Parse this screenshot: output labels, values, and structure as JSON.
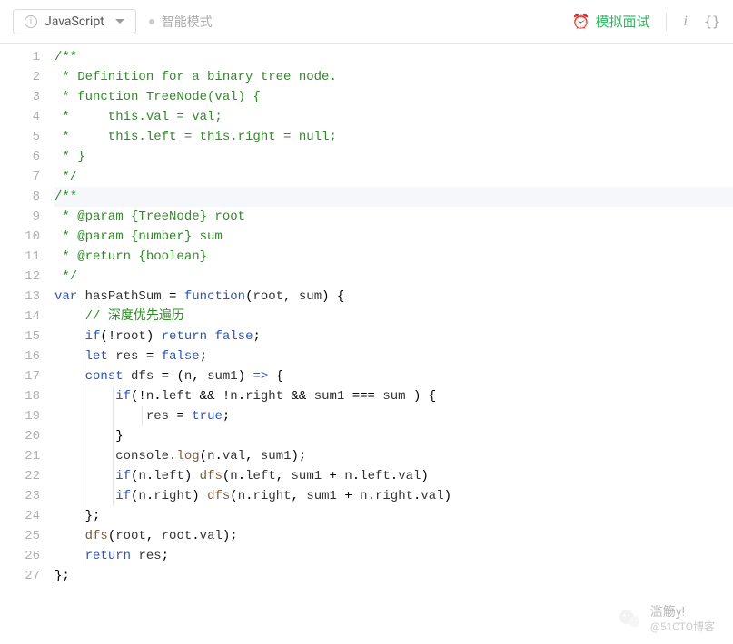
{
  "toolbar": {
    "language": "JavaScript",
    "mode_label": "智能模式",
    "interview_label": "模拟面试"
  },
  "icons": {
    "info": "i",
    "braces": "{}"
  },
  "watermark": {
    "line1": "滥觞y!",
    "line2": "@51CTO博客"
  },
  "code": {
    "highlight_line": 8,
    "lines": [
      {
        "n": 1,
        "seg": [
          {
            "t": "/**",
            "c": "c-comment"
          }
        ]
      },
      {
        "n": 2,
        "seg": [
          {
            "t": " * Definition for a binary tree node.",
            "c": "c-comment"
          }
        ]
      },
      {
        "n": 3,
        "seg": [
          {
            "t": " * function TreeNode(val) {",
            "c": "c-comment"
          }
        ]
      },
      {
        "n": 4,
        "seg": [
          {
            "t": " *     this.val = val;",
            "c": "c-comment"
          }
        ]
      },
      {
        "n": 5,
        "seg": [
          {
            "t": " *     this.left = this.right = null;",
            "c": "c-comment"
          }
        ]
      },
      {
        "n": 6,
        "seg": [
          {
            "t": " * }",
            "c": "c-comment"
          }
        ]
      },
      {
        "n": 7,
        "seg": [
          {
            "t": " */",
            "c": "c-comment"
          }
        ]
      },
      {
        "n": 8,
        "seg": [
          {
            "t": "/**",
            "c": "c-comment"
          }
        ]
      },
      {
        "n": 9,
        "seg": [
          {
            "t": " * @param {TreeNode} root",
            "c": "c-comment"
          }
        ]
      },
      {
        "n": 10,
        "seg": [
          {
            "t": " * @param {number} sum",
            "c": "c-comment"
          }
        ]
      },
      {
        "n": 11,
        "seg": [
          {
            "t": " * @return {boolean}",
            "c": "c-comment"
          }
        ]
      },
      {
        "n": 12,
        "seg": [
          {
            "t": " */",
            "c": "c-comment"
          }
        ]
      },
      {
        "n": 13,
        "guides": [],
        "seg": [
          {
            "t": "var",
            "c": "c-keyword"
          },
          {
            "t": " "
          },
          {
            "t": "hasPathSum",
            "c": "c-ident"
          },
          {
            "t": " = "
          },
          {
            "t": "function",
            "c": "c-keyword"
          },
          {
            "t": "("
          },
          {
            "t": "root",
            "c": "c-ident"
          },
          {
            "t": ", "
          },
          {
            "t": "sum",
            "c": "c-ident"
          },
          {
            "t": ") {"
          }
        ]
      },
      {
        "n": 14,
        "guides": [
          "g1"
        ],
        "seg": [
          {
            "t": "    "
          },
          {
            "t": "// 深度优先遍历",
            "c": "c-comment"
          }
        ]
      },
      {
        "n": 15,
        "guides": [
          "g1"
        ],
        "seg": [
          {
            "t": "    "
          },
          {
            "t": "if",
            "c": "c-keyword"
          },
          {
            "t": "(!"
          },
          {
            "t": "root",
            "c": "c-ident"
          },
          {
            "t": ") "
          },
          {
            "t": "return",
            "c": "c-keyword"
          },
          {
            "t": " "
          },
          {
            "t": "false",
            "c": "c-keyword"
          },
          {
            "t": ";"
          }
        ]
      },
      {
        "n": 16,
        "guides": [
          "g1"
        ],
        "seg": [
          {
            "t": "    "
          },
          {
            "t": "let",
            "c": "c-keyword"
          },
          {
            "t": " "
          },
          {
            "t": "res",
            "c": "c-ident"
          },
          {
            "t": " = "
          },
          {
            "t": "false",
            "c": "c-keyword"
          },
          {
            "t": ";"
          }
        ]
      },
      {
        "n": 17,
        "guides": [
          "g1"
        ],
        "seg": [
          {
            "t": "    "
          },
          {
            "t": "const",
            "c": "c-keyword"
          },
          {
            "t": " "
          },
          {
            "t": "dfs",
            "c": "c-ident"
          },
          {
            "t": " = ("
          },
          {
            "t": "n",
            "c": "c-ident"
          },
          {
            "t": ", "
          },
          {
            "t": "sum1",
            "c": "c-ident"
          },
          {
            "t": ") "
          },
          {
            "t": "=>",
            "c": "c-keyword"
          },
          {
            "t": " {"
          }
        ]
      },
      {
        "n": 18,
        "guides": [
          "g1",
          "g2"
        ],
        "seg": [
          {
            "t": "        "
          },
          {
            "t": "if",
            "c": "c-keyword"
          },
          {
            "t": "(!"
          },
          {
            "t": "n",
            "c": "c-ident"
          },
          {
            "t": "."
          },
          {
            "t": "left",
            "c": "c-ident"
          },
          {
            "t": " && !"
          },
          {
            "t": "n",
            "c": "c-ident"
          },
          {
            "t": "."
          },
          {
            "t": "right",
            "c": "c-ident"
          },
          {
            "t": " && "
          },
          {
            "t": "sum1",
            "c": "c-ident"
          },
          {
            "t": " === "
          },
          {
            "t": "sum",
            "c": "c-ident"
          },
          {
            "t": " ) {"
          }
        ]
      },
      {
        "n": 19,
        "guides": [
          "g1",
          "g2",
          "g3"
        ],
        "seg": [
          {
            "t": "            "
          },
          {
            "t": "res",
            "c": "c-ident"
          },
          {
            "t": " = "
          },
          {
            "t": "true",
            "c": "c-keyword"
          },
          {
            "t": ";"
          }
        ]
      },
      {
        "n": 20,
        "guides": [
          "g1",
          "g2"
        ],
        "seg": [
          {
            "t": "        }"
          }
        ]
      },
      {
        "n": 21,
        "guides": [
          "g1",
          "g2"
        ],
        "seg": [
          {
            "t": "        "
          },
          {
            "t": "console",
            "c": "c-ident"
          },
          {
            "t": "."
          },
          {
            "t": "log",
            "c": "c-func"
          },
          {
            "t": "("
          },
          {
            "t": "n",
            "c": "c-ident"
          },
          {
            "t": "."
          },
          {
            "t": "val",
            "c": "c-ident"
          },
          {
            "t": ", "
          },
          {
            "t": "sum1",
            "c": "c-ident"
          },
          {
            "t": ");"
          }
        ]
      },
      {
        "n": 22,
        "guides": [
          "g1",
          "g2"
        ],
        "seg": [
          {
            "t": "        "
          },
          {
            "t": "if",
            "c": "c-keyword"
          },
          {
            "t": "("
          },
          {
            "t": "n",
            "c": "c-ident"
          },
          {
            "t": "."
          },
          {
            "t": "left",
            "c": "c-ident"
          },
          {
            "t": ") "
          },
          {
            "t": "dfs",
            "c": "c-func"
          },
          {
            "t": "("
          },
          {
            "t": "n",
            "c": "c-ident"
          },
          {
            "t": "."
          },
          {
            "t": "left",
            "c": "c-ident"
          },
          {
            "t": ", "
          },
          {
            "t": "sum1",
            "c": "c-ident"
          },
          {
            "t": " + "
          },
          {
            "t": "n",
            "c": "c-ident"
          },
          {
            "t": "."
          },
          {
            "t": "left",
            "c": "c-ident"
          },
          {
            "t": "."
          },
          {
            "t": "val",
            "c": "c-ident"
          },
          {
            "t": ")"
          }
        ]
      },
      {
        "n": 23,
        "guides": [
          "g1",
          "g2"
        ],
        "seg": [
          {
            "t": "        "
          },
          {
            "t": "if",
            "c": "c-keyword"
          },
          {
            "t": "("
          },
          {
            "t": "n",
            "c": "c-ident"
          },
          {
            "t": "."
          },
          {
            "t": "right",
            "c": "c-ident"
          },
          {
            "t": ") "
          },
          {
            "t": "dfs",
            "c": "c-func"
          },
          {
            "t": "("
          },
          {
            "t": "n",
            "c": "c-ident"
          },
          {
            "t": "."
          },
          {
            "t": "right",
            "c": "c-ident"
          },
          {
            "t": ", "
          },
          {
            "t": "sum1",
            "c": "c-ident"
          },
          {
            "t": " + "
          },
          {
            "t": "n",
            "c": "c-ident"
          },
          {
            "t": "."
          },
          {
            "t": "right",
            "c": "c-ident"
          },
          {
            "t": "."
          },
          {
            "t": "val",
            "c": "c-ident"
          },
          {
            "t": ")"
          }
        ]
      },
      {
        "n": 24,
        "guides": [
          "g1"
        ],
        "seg": [
          {
            "t": "    };"
          }
        ]
      },
      {
        "n": 25,
        "guides": [
          "g1"
        ],
        "seg": [
          {
            "t": "    "
          },
          {
            "t": "dfs",
            "c": "c-func"
          },
          {
            "t": "("
          },
          {
            "t": "root",
            "c": "c-ident"
          },
          {
            "t": ", "
          },
          {
            "t": "root",
            "c": "c-ident"
          },
          {
            "t": "."
          },
          {
            "t": "val",
            "c": "c-ident"
          },
          {
            "t": ");"
          }
        ]
      },
      {
        "n": 26,
        "guides": [
          "g1"
        ],
        "seg": [
          {
            "t": "    "
          },
          {
            "t": "return",
            "c": "c-keyword"
          },
          {
            "t": " "
          },
          {
            "t": "res",
            "c": "c-ident"
          },
          {
            "t": ";"
          }
        ]
      },
      {
        "n": 27,
        "seg": [
          {
            "t": "};"
          }
        ]
      }
    ]
  }
}
